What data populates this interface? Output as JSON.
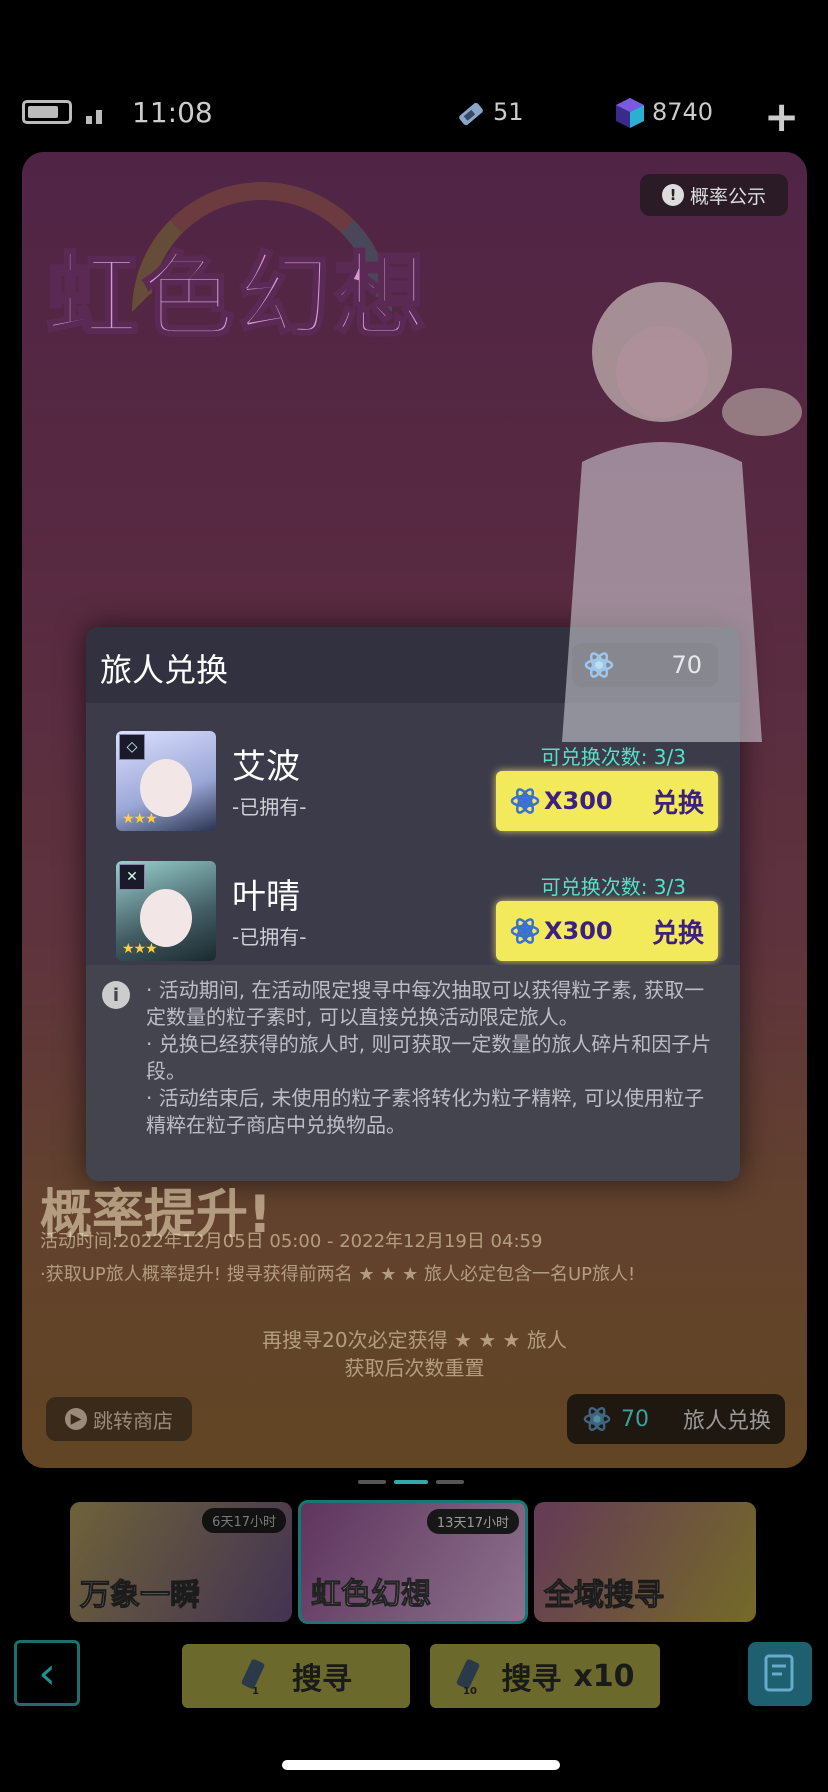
{
  "status": {
    "time": "11:08",
    "tickets": "51",
    "gems": "8740",
    "plus_label": "+"
  },
  "banner": {
    "title": "虹色幻想",
    "prob_button": "概率公示",
    "rate_title": "概率提升!",
    "rate_time": "活动时间:2022年12月05日 05:00 - 2022年12月19日 04:59",
    "rate_desc": "·获取UP旅人概率提升! 搜寻获得前两名 ★ ★ ★ 旅人必定包含一名UP旅人!",
    "pity_line1": "再搜寻20次必定获得 ★ ★ ★ 旅人",
    "pity_line2": "获取后次数重置",
    "jump_button": "跳转商店",
    "exchange_count": "70",
    "exchange_button": "旅人兑换"
  },
  "tabs": [
    {
      "label": "万象一瞬",
      "timer": "6天17小时"
    },
    {
      "label": "虹色幻想",
      "timer": "13天17小时"
    },
    {
      "label": "全域搜寻",
      "timer": ""
    }
  ],
  "bottom": {
    "search_single": "搜寻",
    "search_single_count": "1",
    "search_multi": "搜寻",
    "search_multi_mult": "x10",
    "search_multi_count": "10"
  },
  "modal": {
    "title": "旅人兑换",
    "particle_count": "70",
    "items": [
      {
        "name": "艾波",
        "owned": "-已拥有-",
        "times": "可兑换次数: 3/3",
        "cost": "X300",
        "button": "兑换"
      },
      {
        "name": "叶晴",
        "owned": "-已拥有-",
        "times": "可兑换次数: 3/3",
        "cost": "X300",
        "button": "兑换"
      }
    ],
    "info": [
      "· 活动期间, 在活动限定搜寻中每次抽取可以获得粒子素, 获取一定数量的粒子素时, 可以直接兑换活动限定旅人。",
      "· 兑换已经获得的旅人时, 则可获取一定数量的旅人碎片和因子片段。",
      "· 活动结束后, 未使用的粒子素将转化为粒子精粹, 可以使用粒子精粹在粒子商店中兑换物品。"
    ]
  },
  "colors": {
    "accent_teal": "#58e0c6",
    "button_yellow": "#f2ea5a",
    "button_text": "#3c2080",
    "modal_bg": "#3b3b4a"
  },
  "icons": [
    "battery-icon",
    "signal-icon",
    "ticket-icon",
    "gem-icon",
    "plus-icon",
    "info-icon",
    "atom-icon",
    "back-icon",
    "notes-icon"
  ]
}
